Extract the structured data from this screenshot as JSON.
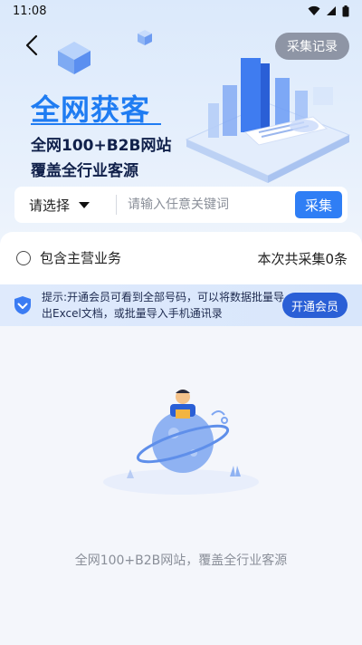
{
  "status_bar": {
    "time": "11:08",
    "icons": [
      "wifi-icon",
      "signal-icon",
      "battery-icon"
    ]
  },
  "header": {
    "back_icon": "chevron-left-icon",
    "record_label": "采集记录"
  },
  "hero": {
    "headline": "全网获客",
    "sub1": "全网100+B2B网站",
    "sub2": "覆盖全行业客源"
  },
  "search": {
    "select_label": "请选择",
    "placeholder": "请输入任意关键词",
    "value": "",
    "button_label": "采集"
  },
  "options": {
    "checkbox_label": "包含主营业务",
    "checked": false,
    "count_text": "本次共采集0条"
  },
  "tip": {
    "icon": "shield-vip-icon",
    "text": "提示:开通会员可看到全部号码，可以将数据批量导出Excel文档，或批量导入手机通讯录",
    "button_label": "开通会员"
  },
  "empty": {
    "text": "全网100+B2B网站，覆盖全行业客源"
  },
  "colors": {
    "primary": "#2f7ef5",
    "headline": "#1f7cf2",
    "vip_button": "#2a5fd6",
    "record_button": "#8e95a5"
  }
}
